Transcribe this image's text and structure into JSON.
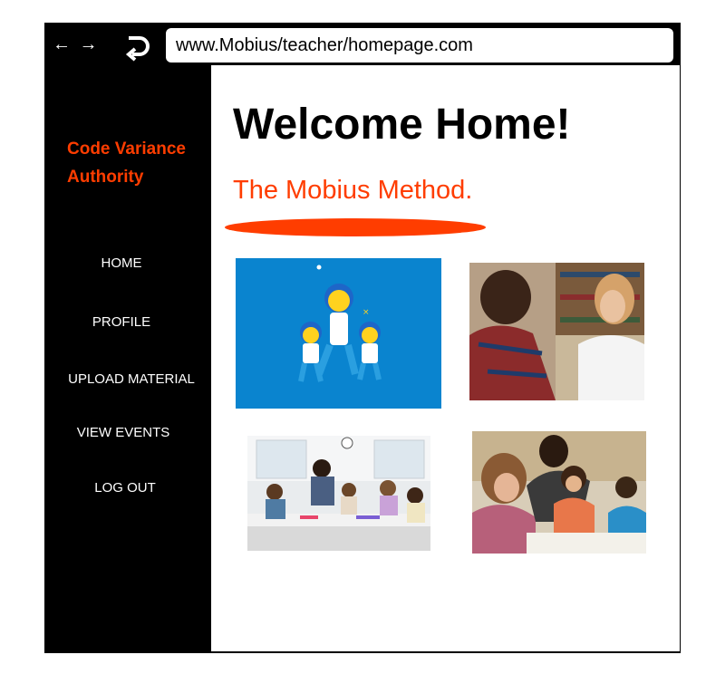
{
  "browser": {
    "back_forward_label": "← →",
    "url": "www.Mobius/teacher/homepage.com"
  },
  "sidebar": {
    "brand_line1": "Code Variance",
    "brand_line2": "Authority",
    "items": [
      {
        "label": "HOME"
      },
      {
        "label": "PROFILE"
      },
      {
        "label": "UPLOAD MATERIAL"
      },
      {
        "label": "VIEW EVENTS"
      },
      {
        "label": "LOG OUT"
      }
    ]
  },
  "main": {
    "title": "Welcome Home!",
    "subtitle": "The Mobius Method."
  },
  "colors": {
    "accent": "#ff3d00",
    "sidebar_bg": "#000000",
    "illustration_bg": "#0a84cf"
  }
}
